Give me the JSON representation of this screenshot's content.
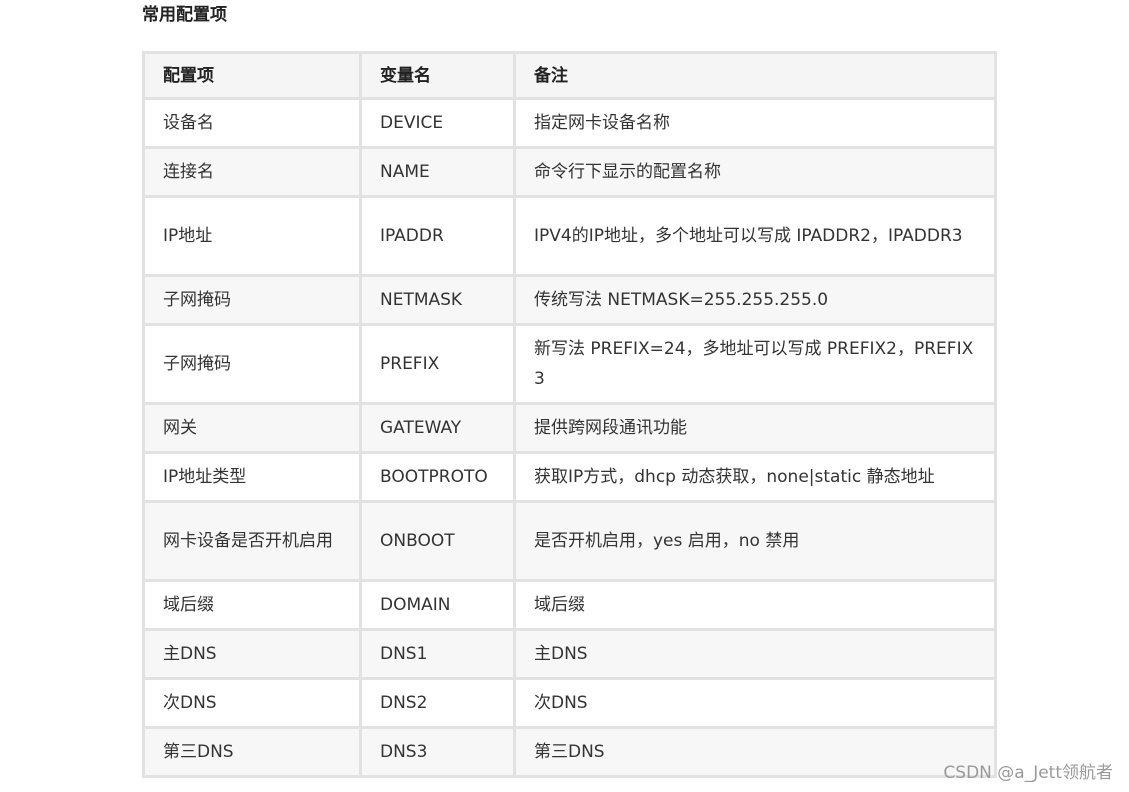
{
  "section": {
    "title": "常用配置项"
  },
  "table": {
    "headers": [
      "配置项",
      "变量名",
      "备注"
    ],
    "rows": [
      [
        "设备名",
        "DEVICE",
        "指定网卡设备名称"
      ],
      [
        "连接名",
        "NAME",
        "命令行下显示的配置名称"
      ],
      [
        "IP地址",
        "IPADDR",
        "IPV4的IP地址，多个地址可以写成 IPADDR2，IPADDR3"
      ],
      [
        "子网掩码",
        "NETMASK",
        "传统写法 NETMASK=255.255.255.0"
      ],
      [
        "子网掩码",
        "PREFIX",
        "新写法 PREFIX=24，多地址可以写成 PREFIX2，PREFIX3"
      ],
      [
        "网关",
        "GATEWAY",
        "提供跨网段通讯功能"
      ],
      [
        "IP地址类型",
        "BOOTPROTO",
        "获取IP方式，dhcp 动态获取，none|static 静态地址"
      ],
      [
        "网卡设备是否开机启用",
        "ONBOOT",
        "是否开机启用，yes 启用，no 禁用"
      ],
      [
        "域后缀",
        "DOMAIN",
        "域后缀"
      ],
      [
        "主DNS",
        "DNS1",
        "主DNS"
      ],
      [
        "次DNS",
        "DNS2",
        "次DNS"
      ],
      [
        "第三DNS",
        "DNS3",
        "第三DNS"
      ]
    ]
  },
  "watermark": "CSDN @a_Jett领航者"
}
